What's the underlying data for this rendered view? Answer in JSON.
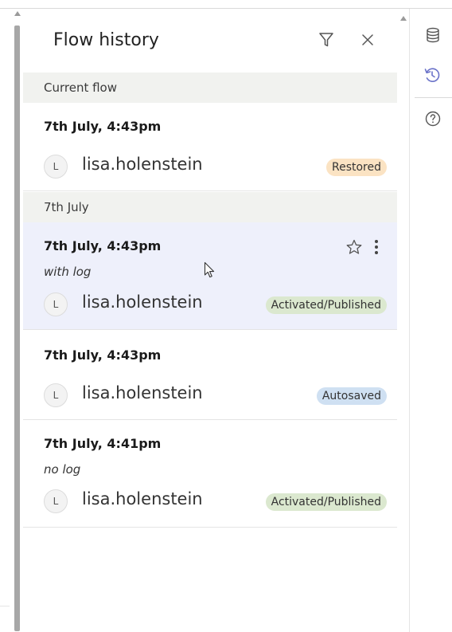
{
  "panel": {
    "title": "Flow history",
    "filter_icon": "filter-icon",
    "close_icon": "close-icon"
  },
  "sections": [
    {
      "label": "Current flow",
      "entries": [
        {
          "time": "7th July, 4:43pm",
          "note": "",
          "avatar": "L",
          "user": "lisa.holenstein",
          "badge": "Restored",
          "badge_color": "#fbe3c3"
        }
      ]
    },
    {
      "label": "7th July",
      "entries": [
        {
          "time": "7th July, 4:43pm",
          "note": "with log",
          "avatar": "L",
          "user": "lisa.holenstein",
          "badge": "Activated/Published",
          "badge_color": "#dbe8cf",
          "selected": true
        },
        {
          "time": "7th July, 4:43pm",
          "note": "",
          "avatar": "L",
          "user": "lisa.holenstein",
          "badge": "Autosaved",
          "badge_color": "#cfe0f2"
        },
        {
          "time": "7th July, 4:41pm",
          "note": "no log",
          "avatar": "L",
          "user": "lisa.holenstein",
          "badge": "Activated/Published",
          "badge_color": "#dbe8cf"
        }
      ]
    }
  ],
  "right_rail": {
    "icons": [
      "database-icon",
      "history-icon",
      "help-icon"
    ]
  },
  "colors": {
    "selected_row": "#eef0fb",
    "section_header": "#f1f2ef",
    "active_rail_icon": "#6b73c9"
  }
}
